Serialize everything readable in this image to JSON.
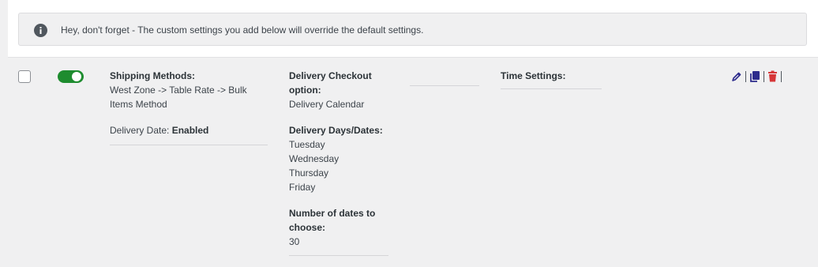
{
  "notice": {
    "icon": "info-icon",
    "text": "Hey, don't forget - The custom settings you add below will override the default settings."
  },
  "row": {
    "selected": false,
    "enabled": true,
    "shipping": {
      "label": "Shipping Methods:",
      "value_line1": "West Zone -> Table Rate -> Bulk",
      "value_line2": "Items Method",
      "delivery_date_label": "Delivery Date:",
      "delivery_date_value": "Enabled"
    },
    "checkout": {
      "label_line1": "Delivery Checkout",
      "label_line2": "option:",
      "value": "Delivery Calendar",
      "days_label": "Delivery Days/Dates:",
      "days": [
        "Tuesday",
        "Wednesday",
        "Thursday",
        "Friday"
      ],
      "number_label_line1": "Number of dates to",
      "number_label_line2": "choose:",
      "number_value": "30"
    },
    "time": {
      "label": "Time Settings:"
    },
    "actions": {
      "edit_icon": "pencil-icon",
      "copy_icon": "copy-icon",
      "delete_icon": "trash-icon"
    }
  },
  "colors": {
    "toggle_on": "#1e8c2f",
    "edit_icon": "#2d2b8c",
    "copy_icon": "#2d2b8c",
    "delete_icon": "#d63638"
  }
}
